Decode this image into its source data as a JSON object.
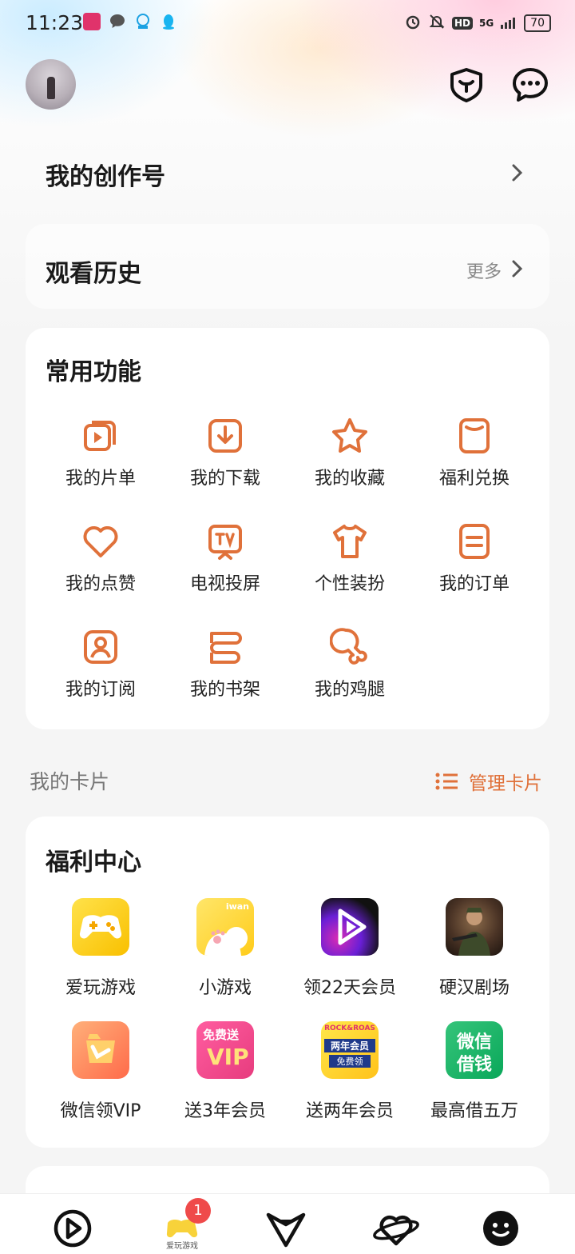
{
  "status_bar": {
    "time": "11:23",
    "battery": "70",
    "network": "5G",
    "hd": "HD"
  },
  "header": {
    "security_icon": "shield-icon",
    "message_icon": "chat-icon"
  },
  "rows": {
    "creator": "我的创作号",
    "history": "观看历史",
    "more": "更多"
  },
  "common": {
    "title": "常用功能",
    "items": [
      {
        "label": "我的片单",
        "icon": "playlist-icon"
      },
      {
        "label": "我的下载",
        "icon": "download-icon"
      },
      {
        "label": "我的收藏",
        "icon": "star-icon"
      },
      {
        "label": "福利兑换",
        "icon": "exchange-icon"
      },
      {
        "label": "我的点赞",
        "icon": "heart-icon"
      },
      {
        "label": "电视投屏",
        "icon": "tv-cast-icon"
      },
      {
        "label": "个性装扮",
        "icon": "shirt-icon"
      },
      {
        "label": "我的订单",
        "icon": "order-icon"
      },
      {
        "label": "我的订阅",
        "icon": "subscribe-icon"
      },
      {
        "label": "我的书架",
        "icon": "bookshelf-icon"
      },
      {
        "label": "我的鸡腿",
        "icon": "drumstick-icon"
      }
    ]
  },
  "my_cards": {
    "title": "我的卡片",
    "manage": "管理卡片"
  },
  "welfare": {
    "title": "福利中心",
    "apps": [
      {
        "label": "爱玩游戏",
        "icon": "game-controller-icon"
      },
      {
        "label": "小游戏",
        "icon": "iwan-cat-icon",
        "icon_text": "iwan"
      },
      {
        "label": "领22天会员",
        "icon": "video-play-icon"
      },
      {
        "label": "硬汉剧场",
        "icon": "soldier-poster-icon"
      },
      {
        "label": "微信领VIP",
        "icon": "vip-box-icon"
      },
      {
        "label": "送3年会员",
        "icon": "vip-ticket-icon",
        "icon_text": "免费送",
        "icon_text2": "VIP"
      },
      {
        "label": "送两年会员",
        "icon": "rock-roast-icon",
        "icon_text": "ROCK&ROAS",
        "icon_text2": "两年会员",
        "icon_text3": "免费领"
      },
      {
        "label": "最高借五万",
        "icon": "wechat-loan-icon",
        "icon_text": "微信",
        "icon_text2": "借钱"
      }
    ]
  },
  "bottom_nav": {
    "badge_count": "1",
    "game_tab_text": "爱玩游戏"
  }
}
